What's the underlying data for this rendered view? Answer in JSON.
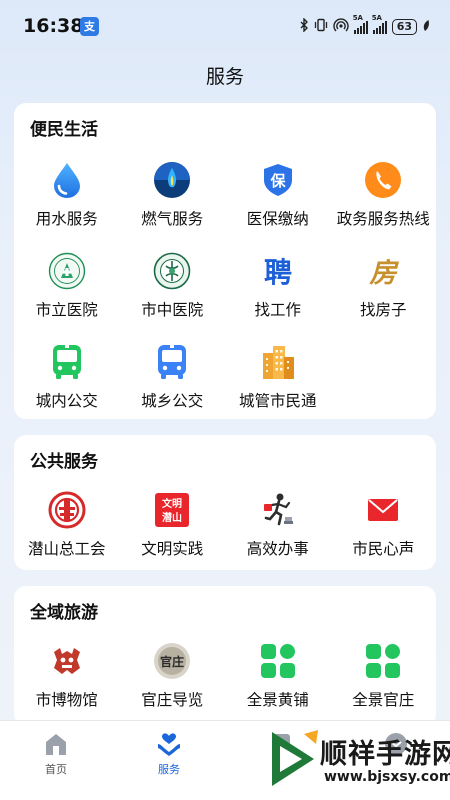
{
  "status_bar": {
    "time": "16:38",
    "app_badge": "支",
    "signal_tag_1": "5A",
    "signal_tag_2": "5A",
    "battery": "63"
  },
  "header": {
    "title": "服务"
  },
  "sections": {
    "life": {
      "title": "便民生活",
      "items": [
        {
          "label": "用水服务",
          "icon": "water-drop-icon"
        },
        {
          "label": "燃气服务",
          "icon": "gas-flame-icon"
        },
        {
          "label": "医保缴纳",
          "icon": "medical-insurance-shield-icon",
          "icon_text": "保"
        },
        {
          "label": "政务服务热线",
          "icon": "phone-hotline-icon"
        },
        {
          "label": "市立医院",
          "icon": "city-hospital-logo-icon"
        },
        {
          "label": "市中医院",
          "icon": "tcm-hospital-logo-icon"
        },
        {
          "label": "找工作",
          "icon": "recruit-icon",
          "icon_text": "聘"
        },
        {
          "label": "找房子",
          "icon": "house-icon",
          "icon_text": "房"
        },
        {
          "label": "城内公交",
          "icon": "city-bus-icon"
        },
        {
          "label": "城乡公交",
          "icon": "rural-bus-icon"
        },
        {
          "label": "城管市民通",
          "icon": "city-building-icon"
        }
      ]
    },
    "public": {
      "title": "公共服务",
      "items": [
        {
          "label": "潜山总工会",
          "icon": "trade-union-icon"
        },
        {
          "label": "文明实践",
          "icon": "civilization-practice-icon",
          "icon_text_1": "文明",
          "icon_text_2": "潜山"
        },
        {
          "label": "高效办事",
          "icon": "running-man-icon"
        },
        {
          "label": "市民心声",
          "icon": "mail-envelope-icon"
        }
      ]
    },
    "tour": {
      "title": "全域旅游",
      "items": [
        {
          "label": "市博物馆",
          "icon": "museum-icon"
        },
        {
          "label": "官庄导览",
          "icon": "guanzhuang-guide-icon",
          "icon_text": "官庄"
        },
        {
          "label": "全景黄铺",
          "icon": "panorama-grid-icon"
        },
        {
          "label": "全景官庄",
          "icon": "panorama-grid-icon"
        }
      ]
    }
  },
  "bottom_nav": [
    {
      "label": "首页",
      "icon": "home-icon",
      "active": false
    },
    {
      "label": "服务",
      "icon": "service-heart-hands-icon",
      "active": true
    }
  ],
  "watermark": {
    "text": "顺祥手游网",
    "url": "www.bjsxsy.com"
  },
  "colors": {
    "accent": "#1b66d9",
    "card_bg": "#ffffff",
    "page_bg": "#e9f0fa",
    "green": "#22c55e",
    "red": "#e8262b",
    "orange": "#ff8c1a"
  }
}
